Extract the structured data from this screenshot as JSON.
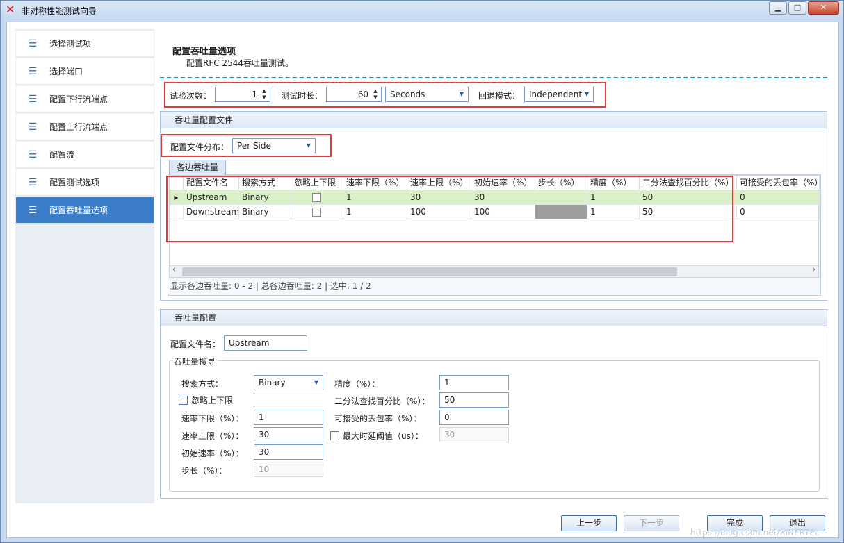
{
  "window": {
    "title": "非对称性能测试向导",
    "controls": {
      "minimize": "▁",
      "maximize": "□",
      "close": "✕"
    }
  },
  "sidebar": {
    "items": [
      {
        "label": "选择测试项",
        "active": false
      },
      {
        "label": "选择端口",
        "active": false
      },
      {
        "label": "配置下行流端点",
        "active": false
      },
      {
        "label": "配置上行流端点",
        "active": false
      },
      {
        "label": "配置流",
        "active": false
      },
      {
        "label": "配置测试选项",
        "active": false
      },
      {
        "label": "配置吞吐量选项",
        "active": true
      }
    ]
  },
  "header": {
    "title": "配置吞吐量选项",
    "subtitle": "配置RFC 2544吞吐量测试。"
  },
  "top_options": {
    "trials_label": "试验次数：",
    "trials_value": "1",
    "duration_label": "测试时长：",
    "duration_value": "60",
    "duration_unit": "Seconds",
    "backoff_label": "回退模式：",
    "backoff_value": "Independent"
  },
  "profile_panel": {
    "title": "吞吐量配置文件",
    "distribution_label": "配置文件分布：",
    "distribution_value": "Per Side",
    "tab_label": "各边吞吐量",
    "columns": [
      "配置文件名",
      "搜索方式",
      "忽略上下限",
      "速率下限（%）",
      "速率上限（%）",
      "初始速率（%）",
      "步长（%）",
      "精度（%）",
      "二分法查找百分比（%）",
      "可接受的丢包率（%）"
    ],
    "rows": [
      {
        "name": "Upstream",
        "search": "Binary",
        "ignore": false,
        "rate_min": "1",
        "rate_max": "30",
        "init_rate": "30",
        "step": "",
        "precision": "1",
        "binary_pct": "50",
        "loss": "0"
      },
      {
        "name": "Downstream",
        "search": "Binary",
        "ignore": false,
        "rate_min": "1",
        "rate_max": "100",
        "init_rate": "100",
        "step": "",
        "precision": "1",
        "binary_pct": "50",
        "loss": "0"
      }
    ],
    "status": "显示各边吞吐量: 0 - 2 | 总各边吞吐量: 2 | 选中: 1 / 2"
  },
  "config_panel": {
    "title": "吞吐量配置",
    "profile_name_label": "配置文件名：",
    "profile_name_value": "Upstream",
    "search_group_title": "吞吐量搜寻",
    "search_mode_label": "搜索方式：",
    "search_mode_value": "Binary",
    "ignore_limits_label": "忽略上下限",
    "rate_min_label": "速率下限（%）：",
    "rate_min_value": "1",
    "rate_max_label": "速率上限（%）：",
    "rate_max_value": "30",
    "init_rate_label": "初始速率（%）：",
    "init_rate_value": "30",
    "step_label": "步长（%）：",
    "step_value": "10",
    "precision_label": "精度（%）：",
    "precision_value": "1",
    "binary_pct_label": "二分法查找百分比（%）：",
    "binary_pct_value": "50",
    "loss_label": "可接受的丢包率（%）：",
    "loss_value": "0",
    "max_latency_label": "最大时延阈值（us）：",
    "max_latency_value": "30"
  },
  "footer": {
    "prev": "上一步",
    "next": "下一步",
    "finish": "完成",
    "exit": "退出"
  },
  "watermark": "https://blog.csdn.net/XINERTEL",
  "colors": {
    "accent": "#3c7dc7",
    "highlight_border": "#e23a3a",
    "selected_row": "#d9f0c9"
  }
}
